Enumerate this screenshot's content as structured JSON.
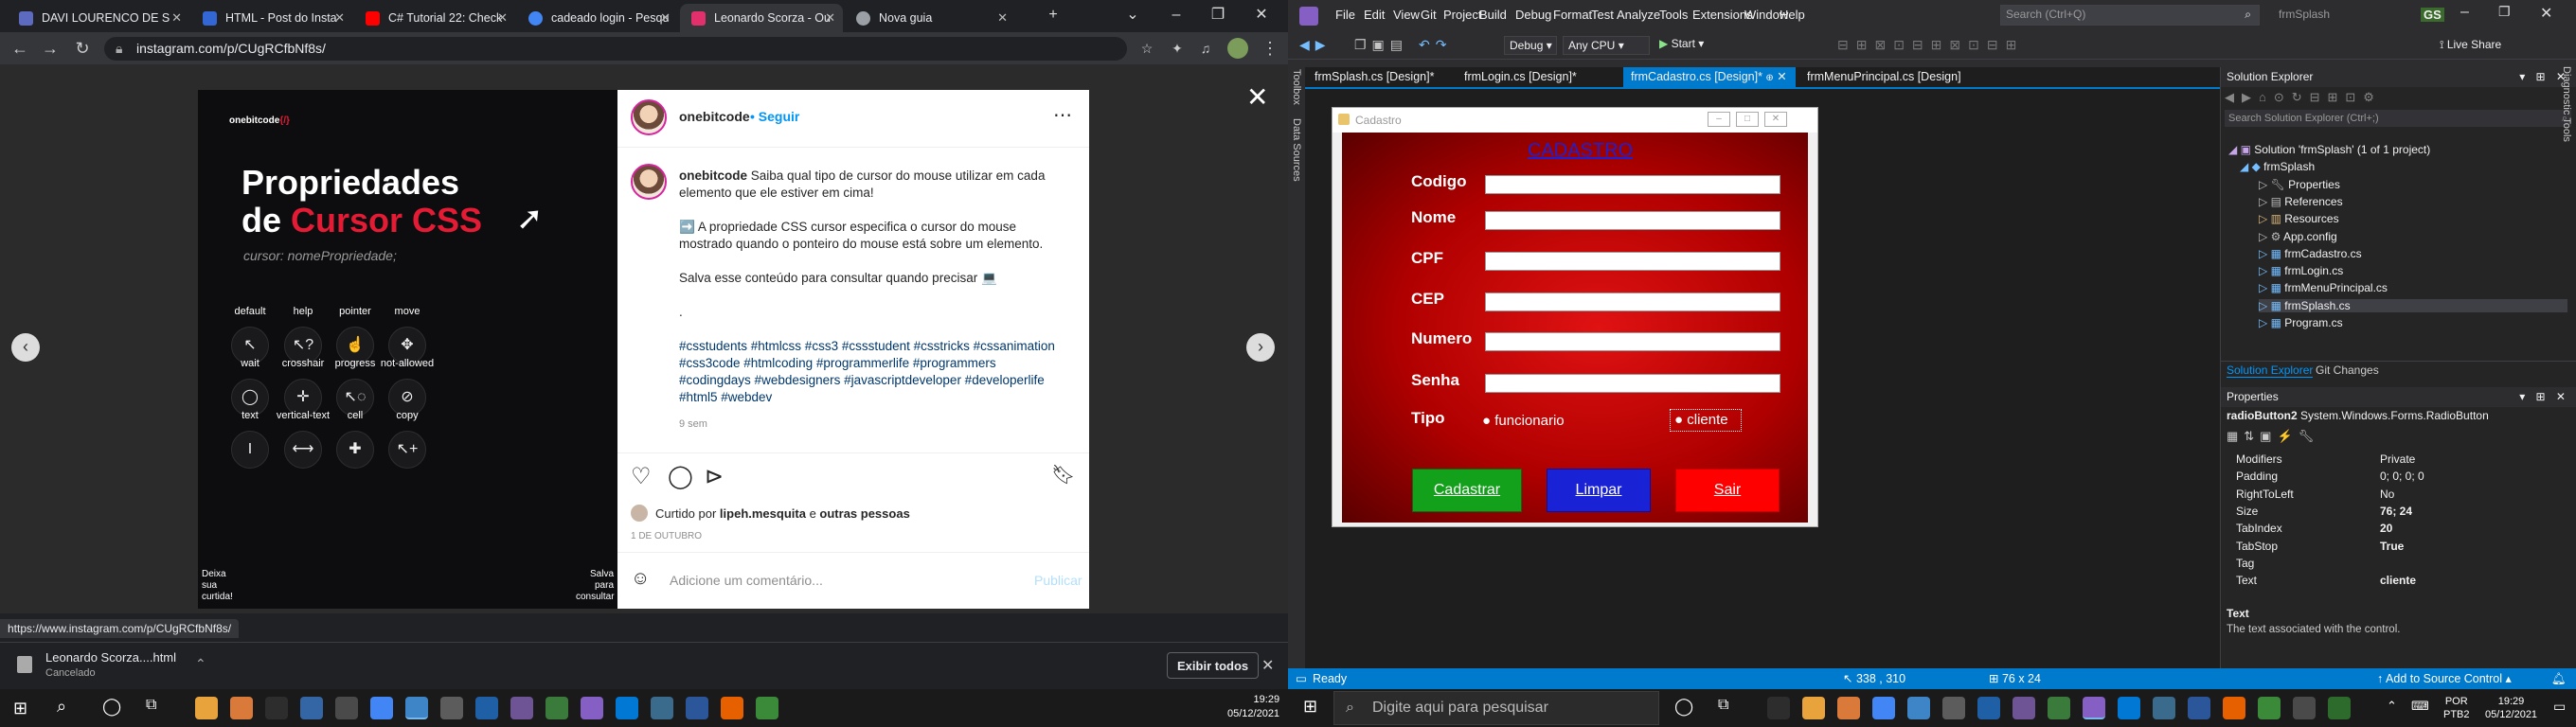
{
  "browser": {
    "tabs": [
      {
        "label": "DAVI LOURENCO DE S",
        "color": "#5c6bc0"
      },
      {
        "label": "HTML - Post do Insta",
        "color": "#3367d6"
      },
      {
        "label": "C# Tutorial 22: Check",
        "color": "#ff0000"
      },
      {
        "label": "cadeado login - Pesqu",
        "color": "#4285f4"
      },
      {
        "label": "Leonardo Scorza - Ou",
        "color": "#e1306c"
      },
      {
        "label": "Nova guia",
        "color": "#9aa0a6"
      }
    ],
    "url": "instagram.com/p/CUgRCfbNf8s/",
    "status_url": "https://www.instagram.com/p/CUgRCfbNf8s/"
  },
  "post_image": {
    "brand": "onebitcode",
    "title_line1": "Propriedades",
    "title_line2_a": "de ",
    "title_line2_b": "Cursor CSS",
    "subtitle": "cursor: nomePropriedade;",
    "cursors": [
      {
        "label": "default",
        "glyph": "↖"
      },
      {
        "label": "help",
        "glyph": "↖?"
      },
      {
        "label": "pointer",
        "glyph": "☝"
      },
      {
        "label": "move",
        "glyph": "✥"
      },
      {
        "label": "wait",
        "glyph": "◯"
      },
      {
        "label": "crosshair",
        "glyph": "✛"
      },
      {
        "label": "progress",
        "glyph": "↖◌"
      },
      {
        "label": "not-allowed",
        "glyph": "⊘"
      },
      {
        "label": "text",
        "glyph": "I"
      },
      {
        "label": "vertical-text",
        "glyph": "⟷"
      },
      {
        "label": "cell",
        "glyph": "✚"
      },
      {
        "label": "copy",
        "glyph": "↖+"
      }
    ],
    "corner_left": "Deixa sua curtida!",
    "corner_right": "Salva para consultar"
  },
  "post": {
    "username": "onebitcode",
    "follow": "Seguir",
    "caption": "Saiba qual tipo de cursor do mouse utilizar em cada elemento que ele estiver em cima!",
    "para2": "➡️ A propriedade CSS cursor especifica o cursor do mouse mostrado quando o ponteiro do mouse está sobre um elemento.",
    "para3": "Salva esse conteúdo para consultar quando precisar 💻",
    "dot": ".",
    "hashtags": "#csstudents #htmlcss #css3 #cssstudent #csstricks #cssanimation #css3code #htmlcoding #programmerlife #programmers #codingdays #webdesigners #javascriptdeveloper #developerlife #html5 #webdev",
    "age": "9 sem",
    "liked_by_prefix": "Curtido por ",
    "liked_by_user": "lipeh.mesquita",
    "liked_by_mid": " e ",
    "liked_by_rest": "outras pessoas",
    "date": "1 DE OUTUBRO",
    "comment_placeholder": "Adicione um comentário...",
    "publish": "Publicar"
  },
  "download": {
    "file": "Leonardo Scorza....html",
    "state": "Cancelado",
    "show_all": "Exibir todos"
  },
  "vs": {
    "menu": [
      "File",
      "Edit",
      "View",
      "Git",
      "Project",
      "Build",
      "Debug",
      "Format",
      "Test",
      "Analyze",
      "Tools",
      "Extensions",
      "Window",
      "Help"
    ],
    "search_placeholder": "Search (Ctrl+Q)",
    "solution_name": "frmSplash",
    "user_initials": "GS",
    "live_share": "Live Share",
    "config": "Debug",
    "platform": "Any CPU",
    "start": "Start",
    "doc_tabs": [
      "frmSplash.cs [Design]*",
      "frmLogin.cs [Design]*",
      "frmCadastro.cs [Design]*",
      "frmMenuPrincipal.cs [Design]"
    ],
    "side_left": [
      "Toolbox",
      "Data Sources"
    ],
    "side_right": "Diagnostic Tools",
    "form": {
      "window_title": "Cadastro",
      "heading": "CADASTRO",
      "fields": [
        "Codigo",
        "Nome",
        "CPF",
        "CEP",
        "Numero",
        "Senha"
      ],
      "tipo_label": "Tipo",
      "radio1": "funcionario",
      "radio2": "cliente",
      "btn_cadastrar": "Cadastrar",
      "btn_limpar": "Limpar",
      "btn_sair": "Sair"
    },
    "solution_explorer": {
      "title": "Solution Explorer",
      "search": "Search Solution Explorer (Ctrl+;)",
      "items": [
        "Solution 'frmSplash' (1 of 1 project)",
        "frmSplash",
        "Properties",
        "References",
        "Resources",
        "App.config",
        "frmCadastro.cs",
        "frmLogin.cs",
        "frmMenuPrincipal.cs",
        "frmSplash.cs",
        "Program.cs"
      ],
      "tab1": "Solution Explorer",
      "tab2": "Git Changes"
    },
    "properties": {
      "title": "Properties",
      "object": "radioButton2",
      "type": "System.Windows.Forms.RadioButton",
      "rows": [
        {
          "k": "Modifiers",
          "v": "Private"
        },
        {
          "k": "Padding",
          "v": "0; 0; 0; 0"
        },
        {
          "k": "RightToLeft",
          "v": "No"
        },
        {
          "k": "Size",
          "v": "76; 24"
        },
        {
          "k": "TabIndex",
          "v": "20"
        },
        {
          "k": "TabStop",
          "v": "True"
        },
        {
          "k": "Tag",
          "v": ""
        },
        {
          "k": "Text",
          "v": "cliente"
        }
      ],
      "desc_title": "Text",
      "desc": "The text associated with the control."
    },
    "status": {
      "ready": "Ready",
      "position": "338 , 310",
      "size": "76 x 24",
      "source_control": "Add to Source Control"
    }
  },
  "taskbar": {
    "search_placeholder": "Digite aqui para pesquisar",
    "time_left": "19:29",
    "date_left": "05/12/2021",
    "lang": "POR",
    "kbd": "PTB2",
    "time_right": "19:29",
    "date_right": "05/12/2021"
  }
}
